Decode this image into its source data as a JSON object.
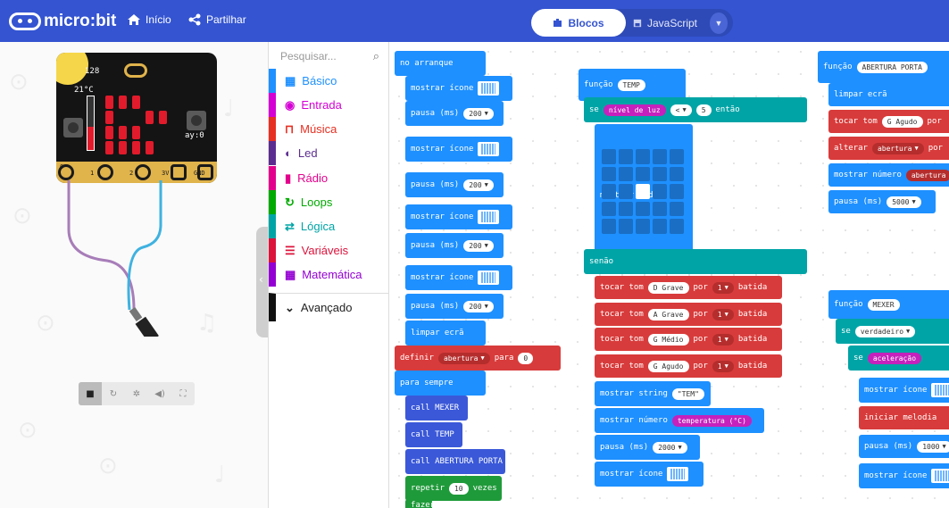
{
  "topbar": {
    "logo_text": "micro:bit",
    "home_label": "Início",
    "share_label": "Partilhar",
    "blocks_label": "Blocos",
    "js_label": "JavaScript",
    "bg": "#3454d1"
  },
  "simulator": {
    "light_value": "128",
    "temp_value": "21°C",
    "accel_label": "ay:0",
    "pins": [
      "0",
      "1",
      "2",
      "3V",
      "GND"
    ],
    "controls": [
      "stop-icon",
      "restart-icon",
      "debug-icon",
      "mute-icon",
      "fullscreen-icon"
    ]
  },
  "toolbox": {
    "search_placeholder": "Pesquisar...",
    "categories": [
      {
        "label": "Básico",
        "color": "#1e90ff",
        "icon": "grid-icon"
      },
      {
        "label": "Entrada",
        "color": "#d400d4",
        "icon": "radio-button-icon"
      },
      {
        "label": "Música",
        "color": "#e63022",
        "icon": "headphones-icon"
      },
      {
        "label": "Led",
        "color": "#5c2d91",
        "icon": "toggle-icon"
      },
      {
        "label": "Rádio",
        "color": "#e3008c",
        "icon": "signal-icon"
      },
      {
        "label": "Loops",
        "color": "#00aa00",
        "icon": "loop-icon"
      },
      {
        "label": "Lógica",
        "color": "#00a4a6",
        "icon": "shuffle-icon"
      },
      {
        "label": "Variáveis",
        "color": "#dc143c",
        "icon": "list-icon"
      },
      {
        "label": "Matemática",
        "color": "#9400d3",
        "icon": "calculator-icon"
      },
      {
        "label": "Avançado",
        "color": "#111111",
        "icon": "chevron-down-icon"
      }
    ]
  },
  "workspace": {
    "on_start": "no arranque",
    "show_icon": "mostrar ícone",
    "pause": "pausa (ms)",
    "pause_200": "200",
    "clear_screen": "limpar ecrã",
    "set": "definir",
    "var_abertura": "abertura",
    "to": "para",
    "zero": "0",
    "forever": "para sempre",
    "call_mexer": "call MEXER",
    "call_temp": "call TEMP",
    "call_abertura": "call ABERTURA PORTA",
    "repeat": "repetir",
    "repeat_n": "10",
    "times": "vezes",
    "do": "fazer",
    "function": "função",
    "temp_name": "TEMP",
    "if": "se",
    "light_level": "nível de luz",
    "lt": "<",
    "five": "5",
    "then": "então",
    "show_leds": "mostrar leds",
    "else": "senão",
    "play_tone": "tocar tom",
    "d_grave": "D Grave",
    "a_grave": "A Grave",
    "g_medio": "G Médio",
    "g_agudo": "G Agudo",
    "for": "por",
    "one_beat": "1",
    "beat": "batida",
    "show_string": "mostrar string",
    "tem_string": "\"TEM\"",
    "show_number": "mostrar número",
    "temperature": "temperatura (°C)",
    "pause_2000": "2000",
    "porta_name": "ABERTURA PORTA",
    "change": "alterar",
    "pause_5000": "5000",
    "mexer_name": "MEXER",
    "true_val": "verdadeiro",
    "acceleration": "aceleração",
    "start_melody": "iniciar melodia",
    "pause_1000": "1000"
  }
}
